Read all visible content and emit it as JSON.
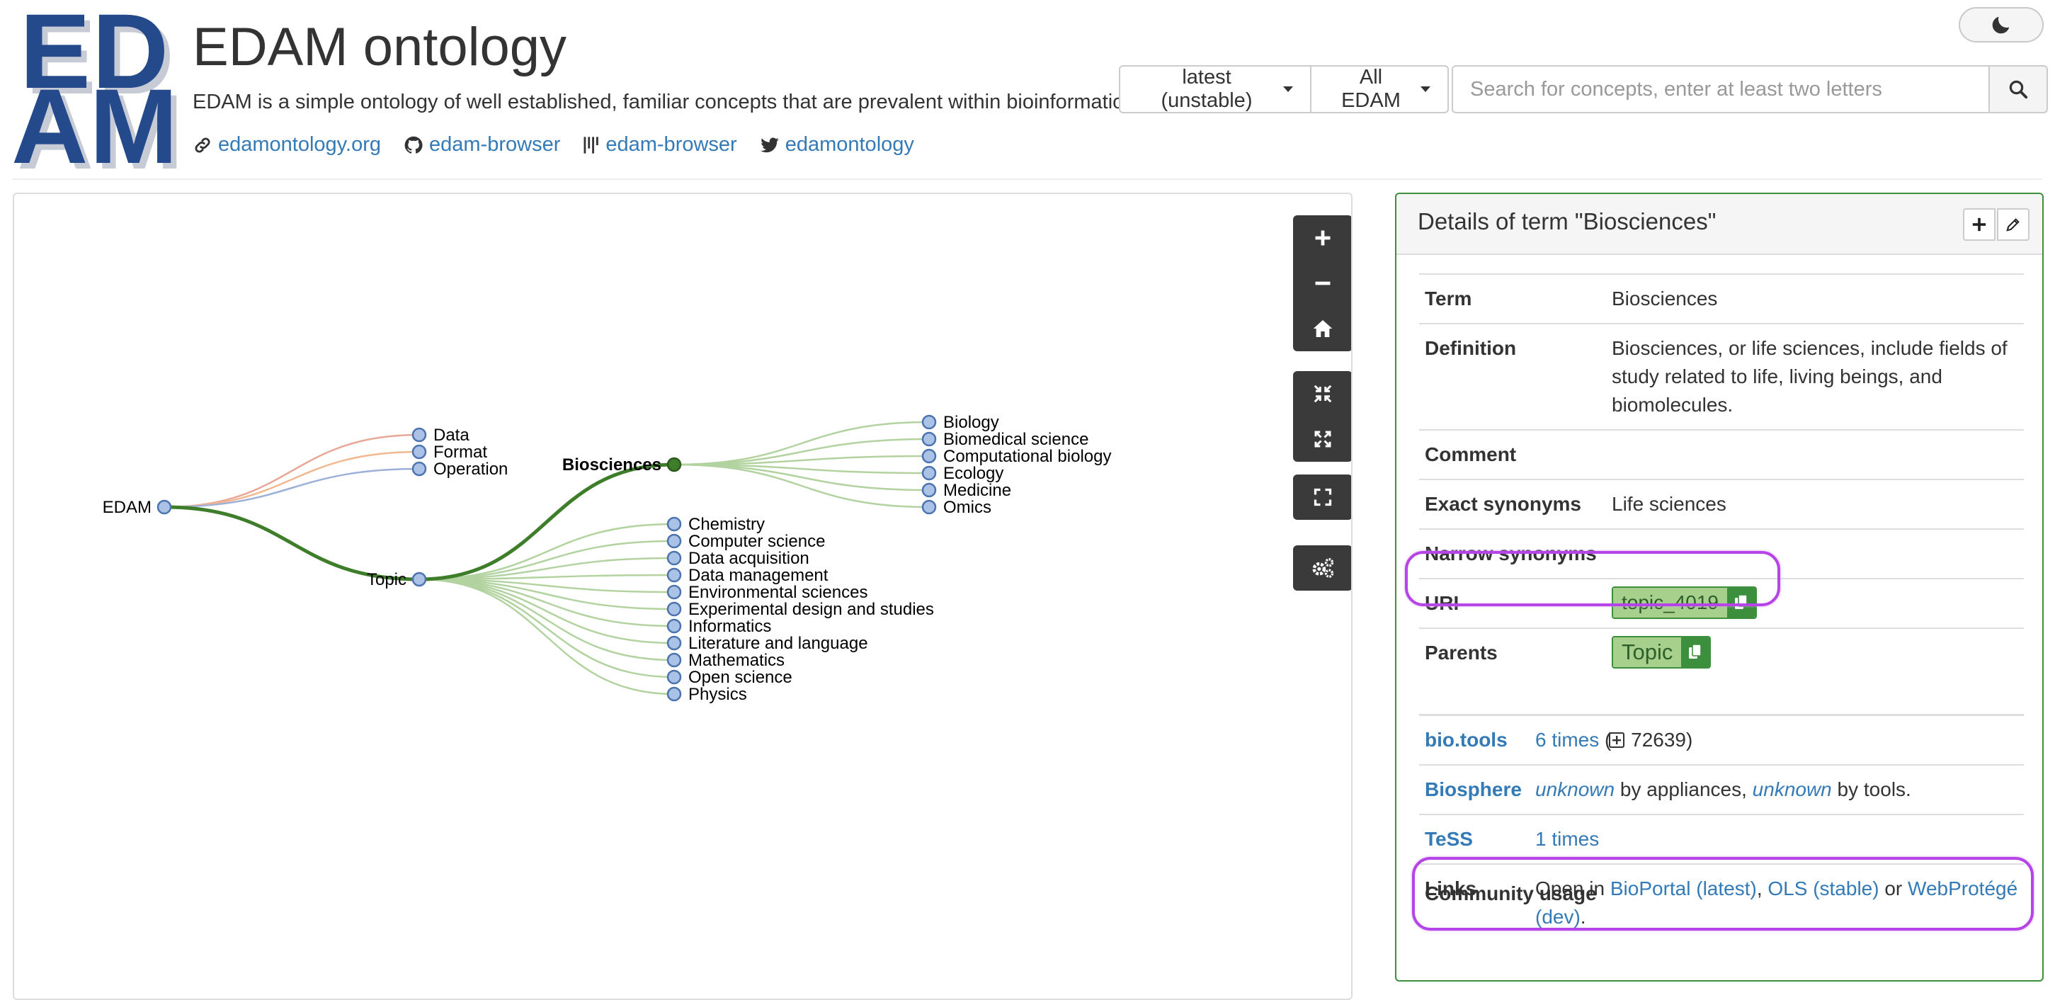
{
  "header": {
    "logo_line1": "ED",
    "logo_line2": "AM",
    "title": "EDAM ontology",
    "tagline": "EDAM is a simple ontology of well established, familiar concepts that are prevalent within bioinformatics.",
    "links": [
      {
        "label": "edamontology.org",
        "icon": "link-icon"
      },
      {
        "label": "edam-browser",
        "icon": "github-icon"
      },
      {
        "label": "edam-browser",
        "icon": "biotools-icon"
      },
      {
        "label": "edamontology",
        "icon": "twitter-icon"
      }
    ],
    "theme_icon": "moon-icon"
  },
  "search": {
    "version_label": "latest (unstable)",
    "scope_label": "All EDAM",
    "placeholder": "Search for concepts, enter at least two letters",
    "value": ""
  },
  "tree": {
    "root": "EDAM",
    "root_children": [
      "Data",
      "Format",
      "Operation"
    ],
    "topic": "Topic",
    "selected": "Biosciences",
    "bio_children": [
      "Biology",
      "Biomedical science",
      "Computational biology",
      "Ecology",
      "Medicine",
      "Omics"
    ],
    "topic_children": [
      "Chemistry",
      "Computer science",
      "Data acquisition",
      "Data management",
      "Environmental sciences",
      "Experimental design and studies",
      "Informatics",
      "Literature and language",
      "Mathematics",
      "Open science",
      "Physics"
    ],
    "colors": {
      "data": "#e8a898",
      "format": "#f2b890",
      "operation": "#9db0d8",
      "path": "#3e7d2a",
      "child_link": "#b2d3a0",
      "node": "#a9c2e6",
      "node_stroke": "#4d73b0",
      "selected_node": "#3e7d2a"
    }
  },
  "controls": {
    "zoom": [
      "plus-icon",
      "minus-icon",
      "home-icon"
    ],
    "expand": [
      "compress-icon",
      "expand-icon"
    ],
    "fullscreen": "fullscreen-icon",
    "settings": "cogs-icon"
  },
  "details": {
    "title": "Details of term \"Biosciences\"",
    "rows": {
      "term_key": "Term",
      "term_val": "Biosciences",
      "def_key": "Definition",
      "def_val": "Biosciences, or life sciences, include fields of study related to life, living beings, and biomolecules.",
      "comment_key": "Comment",
      "exact_key": "Exact synonyms",
      "exact_val": "Life sciences",
      "narrow_key": "Narrow synonyms",
      "uri_key": "URI",
      "uri_val": "topic_4019",
      "parents_key": "Parents",
      "parents_val": "Topic"
    },
    "community": {
      "heading": "Community usage",
      "biotools_key": "bio.tools",
      "biotools_times": "6 times",
      "biotools_paren_open": " (",
      "biotools_count": "72639",
      "biotools_paren_close": ")",
      "biosphere_key": "Biosphere",
      "unknown": "unknown",
      "by_appliances": " by appliances, ",
      "by_tools": " by tools.",
      "tess_key": "TeSS",
      "tess_times": "1 times",
      "links_key": "Links",
      "open_in": "Open in ",
      "bioportal": "BioPortal (latest)",
      "comma": ", ",
      "ols": "OLS (stable)",
      "or": " or ",
      "webprotege": "WebProtégé (dev)",
      "period": "."
    },
    "highlight_color": "#b545e6"
  }
}
